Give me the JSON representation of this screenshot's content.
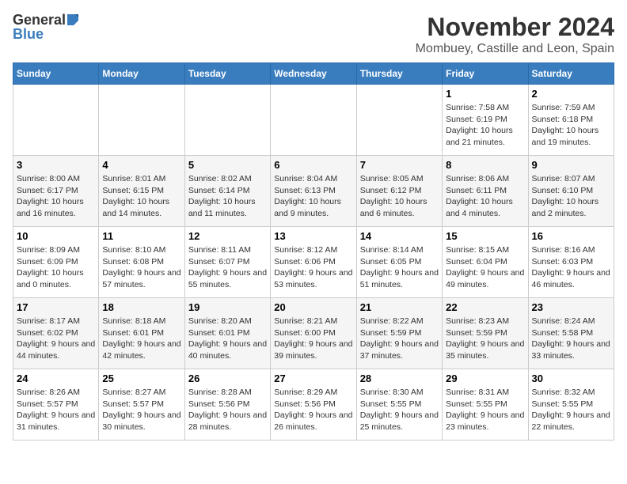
{
  "header": {
    "logo_general": "General",
    "logo_blue": "Blue",
    "month": "November 2024",
    "location": "Mombuey, Castille and Leon, Spain"
  },
  "weekdays": [
    "Sunday",
    "Monday",
    "Tuesday",
    "Wednesday",
    "Thursday",
    "Friday",
    "Saturday"
  ],
  "weeks": [
    [
      {
        "day": "",
        "info": ""
      },
      {
        "day": "",
        "info": ""
      },
      {
        "day": "",
        "info": ""
      },
      {
        "day": "",
        "info": ""
      },
      {
        "day": "",
        "info": ""
      },
      {
        "day": "1",
        "info": "Sunrise: 7:58 AM\nSunset: 6:19 PM\nDaylight: 10 hours and 21 minutes."
      },
      {
        "day": "2",
        "info": "Sunrise: 7:59 AM\nSunset: 6:18 PM\nDaylight: 10 hours and 19 minutes."
      }
    ],
    [
      {
        "day": "3",
        "info": "Sunrise: 8:00 AM\nSunset: 6:17 PM\nDaylight: 10 hours and 16 minutes."
      },
      {
        "day": "4",
        "info": "Sunrise: 8:01 AM\nSunset: 6:15 PM\nDaylight: 10 hours and 14 minutes."
      },
      {
        "day": "5",
        "info": "Sunrise: 8:02 AM\nSunset: 6:14 PM\nDaylight: 10 hours and 11 minutes."
      },
      {
        "day": "6",
        "info": "Sunrise: 8:04 AM\nSunset: 6:13 PM\nDaylight: 10 hours and 9 minutes."
      },
      {
        "day": "7",
        "info": "Sunrise: 8:05 AM\nSunset: 6:12 PM\nDaylight: 10 hours and 6 minutes."
      },
      {
        "day": "8",
        "info": "Sunrise: 8:06 AM\nSunset: 6:11 PM\nDaylight: 10 hours and 4 minutes."
      },
      {
        "day": "9",
        "info": "Sunrise: 8:07 AM\nSunset: 6:10 PM\nDaylight: 10 hours and 2 minutes."
      }
    ],
    [
      {
        "day": "10",
        "info": "Sunrise: 8:09 AM\nSunset: 6:09 PM\nDaylight: 10 hours and 0 minutes."
      },
      {
        "day": "11",
        "info": "Sunrise: 8:10 AM\nSunset: 6:08 PM\nDaylight: 9 hours and 57 minutes."
      },
      {
        "day": "12",
        "info": "Sunrise: 8:11 AM\nSunset: 6:07 PM\nDaylight: 9 hours and 55 minutes."
      },
      {
        "day": "13",
        "info": "Sunrise: 8:12 AM\nSunset: 6:06 PM\nDaylight: 9 hours and 53 minutes."
      },
      {
        "day": "14",
        "info": "Sunrise: 8:14 AM\nSunset: 6:05 PM\nDaylight: 9 hours and 51 minutes."
      },
      {
        "day": "15",
        "info": "Sunrise: 8:15 AM\nSunset: 6:04 PM\nDaylight: 9 hours and 49 minutes."
      },
      {
        "day": "16",
        "info": "Sunrise: 8:16 AM\nSunset: 6:03 PM\nDaylight: 9 hours and 46 minutes."
      }
    ],
    [
      {
        "day": "17",
        "info": "Sunrise: 8:17 AM\nSunset: 6:02 PM\nDaylight: 9 hours and 44 minutes."
      },
      {
        "day": "18",
        "info": "Sunrise: 8:18 AM\nSunset: 6:01 PM\nDaylight: 9 hours and 42 minutes."
      },
      {
        "day": "19",
        "info": "Sunrise: 8:20 AM\nSunset: 6:01 PM\nDaylight: 9 hours and 40 minutes."
      },
      {
        "day": "20",
        "info": "Sunrise: 8:21 AM\nSunset: 6:00 PM\nDaylight: 9 hours and 39 minutes."
      },
      {
        "day": "21",
        "info": "Sunrise: 8:22 AM\nSunset: 5:59 PM\nDaylight: 9 hours and 37 minutes."
      },
      {
        "day": "22",
        "info": "Sunrise: 8:23 AM\nSunset: 5:59 PM\nDaylight: 9 hours and 35 minutes."
      },
      {
        "day": "23",
        "info": "Sunrise: 8:24 AM\nSunset: 5:58 PM\nDaylight: 9 hours and 33 minutes."
      }
    ],
    [
      {
        "day": "24",
        "info": "Sunrise: 8:26 AM\nSunset: 5:57 PM\nDaylight: 9 hours and 31 minutes."
      },
      {
        "day": "25",
        "info": "Sunrise: 8:27 AM\nSunset: 5:57 PM\nDaylight: 9 hours and 30 minutes."
      },
      {
        "day": "26",
        "info": "Sunrise: 8:28 AM\nSunset: 5:56 PM\nDaylight: 9 hours and 28 minutes."
      },
      {
        "day": "27",
        "info": "Sunrise: 8:29 AM\nSunset: 5:56 PM\nDaylight: 9 hours and 26 minutes."
      },
      {
        "day": "28",
        "info": "Sunrise: 8:30 AM\nSunset: 5:55 PM\nDaylight: 9 hours and 25 minutes."
      },
      {
        "day": "29",
        "info": "Sunrise: 8:31 AM\nSunset: 5:55 PM\nDaylight: 9 hours and 23 minutes."
      },
      {
        "day": "30",
        "info": "Sunrise: 8:32 AM\nSunset: 5:55 PM\nDaylight: 9 hours and 22 minutes."
      }
    ]
  ]
}
